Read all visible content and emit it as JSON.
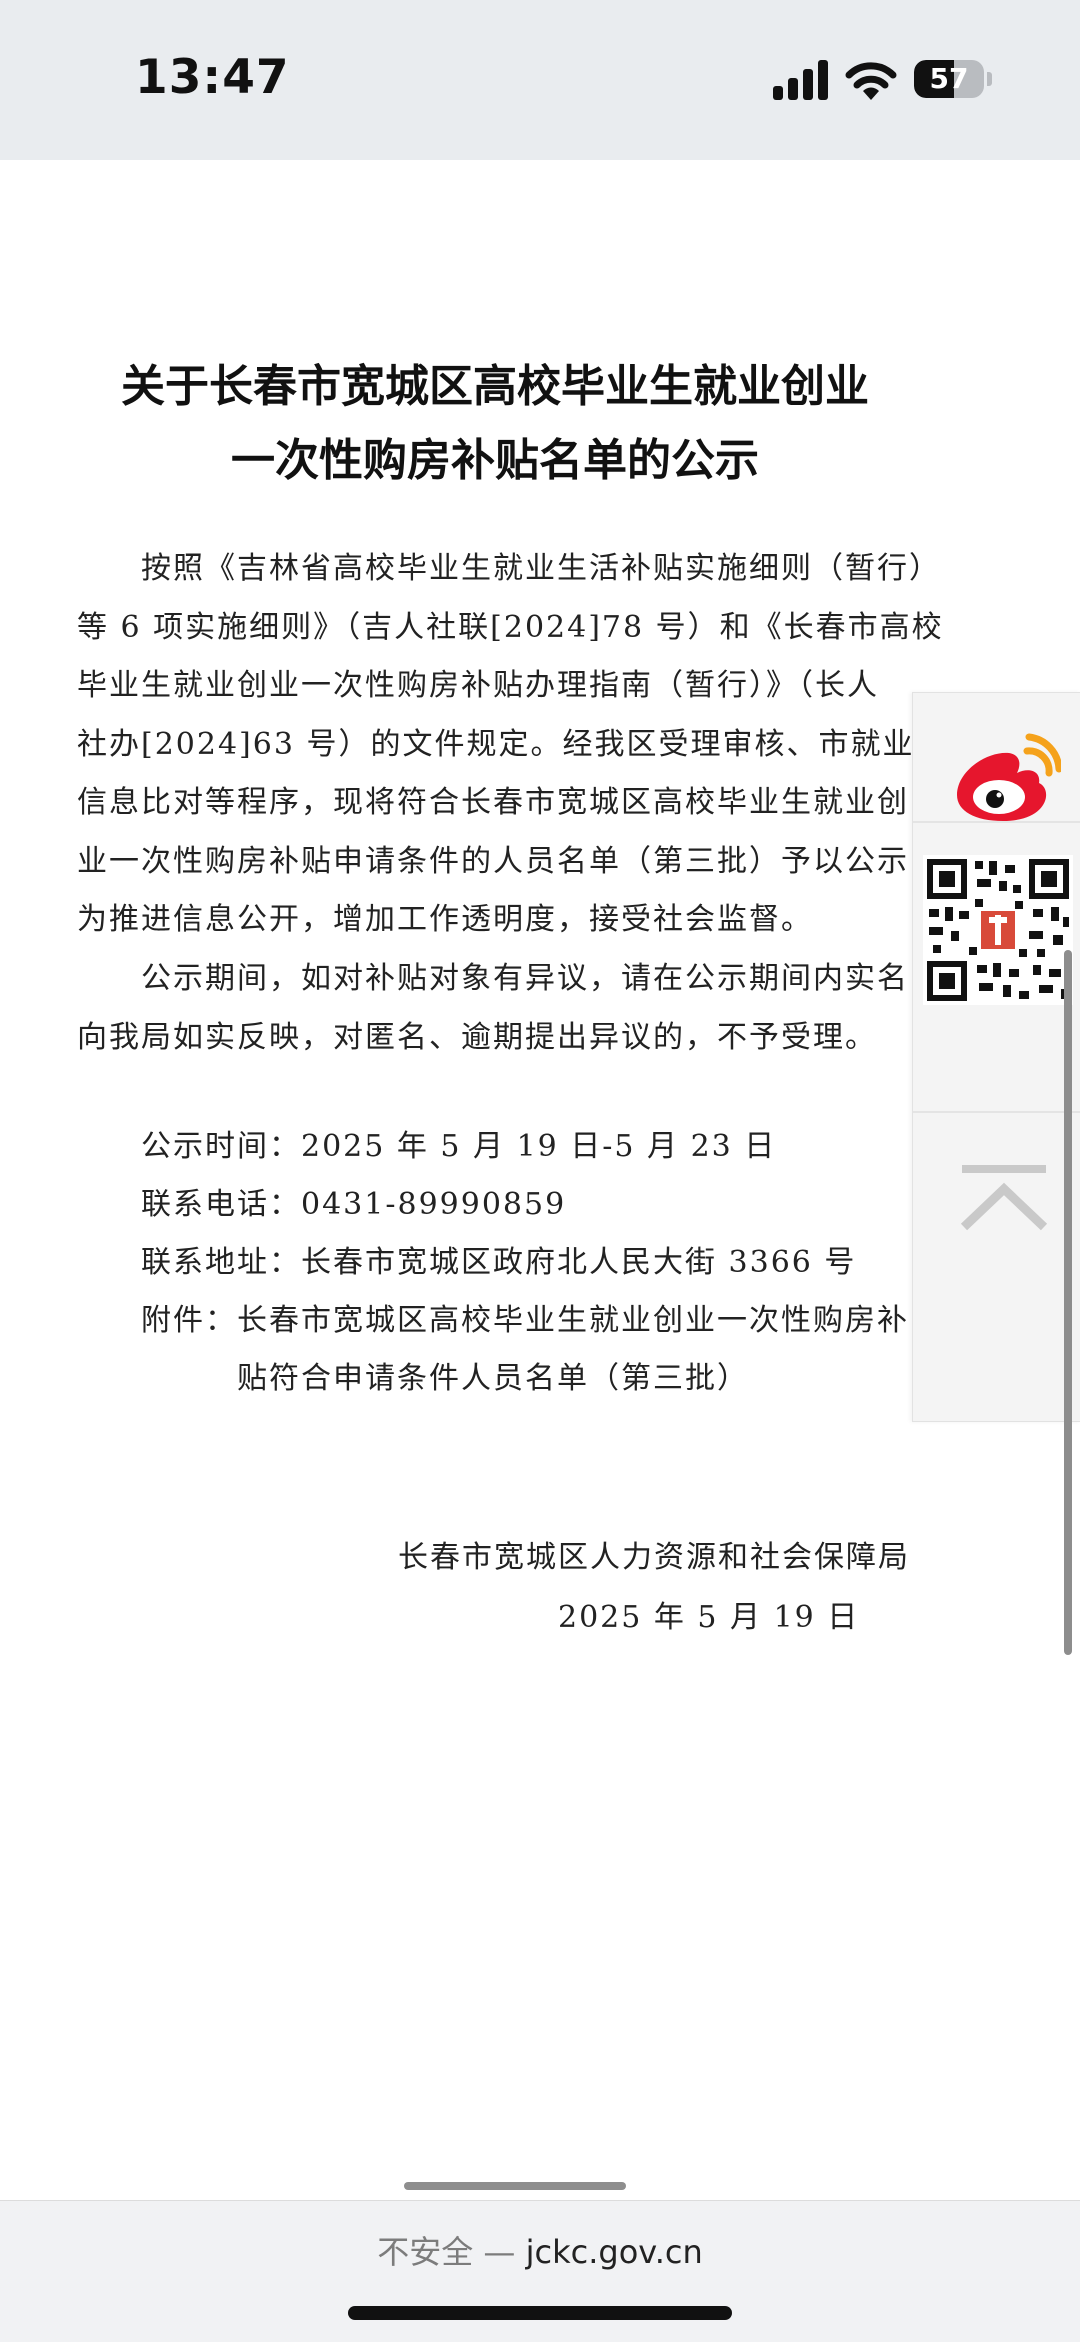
{
  "status_bar": {
    "time": "13:47",
    "battery_level": "57",
    "icons": [
      "signal-icon",
      "wifi-icon",
      "battery-icon"
    ]
  },
  "document": {
    "title_lines": [
      "关于长春市宽城区高校毕业生就业创业",
      "一次性购房补贴名单的公示"
    ],
    "paragraph1_lines": [
      "按照《吉林省高校毕业生就业生活补贴实施细则（暂行）",
      "等 6 项实施细则》（吉人社联[2024]78 号）和《长春市高校",
      "毕业生就业创业一次性购房补贴办理指南（暂行）》（长人",
      "社办[2024]63 号）的文件规定。经我区受理审核、市就业局",
      "信息比对等程序，现将符合长春市宽城区高校毕业生就业创",
      "业一次性购房补贴申请条件的人员名单（第三批）予以公示，",
      "为推进信息公开，增加工作透明度，接受社会监督。"
    ],
    "paragraph2_lines": [
      "公示期间，如对补贴对象有异议，请在公示期间内实名",
      "向我局如实反映，对匿名、逾期提出异议的，不予受理。"
    ],
    "info": {
      "period_label": "公示时间：",
      "period_value": "2025 年 5 月 19 日-5 月 23 日",
      "phone_label": "联系电话：",
      "phone_value": "0431-89990859",
      "address_label": "联系地址：",
      "address_value": "长春市宽城区政府北人民大街 3366 号",
      "attachment_label": "附件：",
      "attachment_line1": "长春市宽城区高校毕业生就业创业一次性购房补",
      "attachment_line2": "贴符合申请条件人员名单（第三批）"
    },
    "signature": {
      "issuer": "长春市宽城区人力资源和社会保障局",
      "date": "2025 年 5 月 19 日"
    }
  },
  "float_panel": {
    "icons": [
      "weibo-icon",
      "qr-code-icon",
      "back-to-top-icon"
    ]
  },
  "browser": {
    "insecure_label": "不安全 —",
    "domain": "jckc.gov.cn"
  },
  "colors": {
    "status_bar_bg": "#e9ecef",
    "weibo_red": "#e6162d",
    "weibo_orange": "#f5a21b",
    "text": "#222222"
  }
}
